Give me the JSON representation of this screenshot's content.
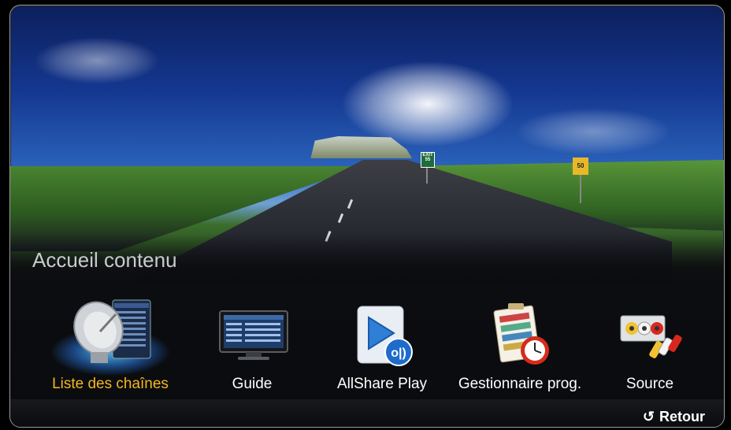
{
  "screen": {
    "title": "Accueil contenu",
    "background": "highway-landscape"
  },
  "road_signs": {
    "exit_text": "EXIT",
    "exit_number": "55",
    "speed_limit": "50"
  },
  "menu": {
    "items": [
      {
        "label": "Liste des chaînes",
        "icon": "satellite-dish-icon",
        "selected": true
      },
      {
        "label": "Guide",
        "icon": "tv-guide-icon",
        "selected": false
      },
      {
        "label": "AllShare Play",
        "icon": "allshare-play-icon",
        "selected": false
      },
      {
        "label": "Gestionnaire prog.",
        "icon": "schedule-manager-icon",
        "selected": false
      },
      {
        "label": "Source",
        "icon": "av-source-icon",
        "selected": false
      }
    ]
  },
  "footer": {
    "return_label": "Retour",
    "return_symbol": "↺"
  },
  "colors": {
    "selected_label": "#f4b71e",
    "label": "#ffffff",
    "title": "#c9cbd0"
  }
}
